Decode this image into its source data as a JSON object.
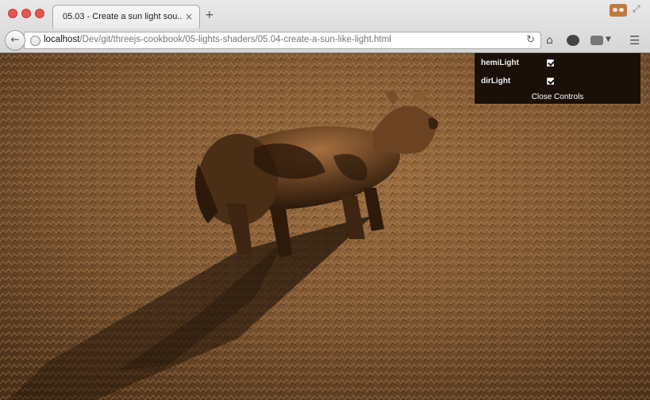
{
  "browser": {
    "tab_title": "05.03 - Create a sun light sou...",
    "tab_close": "×",
    "new_tab": "+",
    "url_host": "localhost",
    "url_path": "/Dev/git/threejs-cookbook/05-lights-shaders/05.04-create-a-sun-like-light.html",
    "icons": [
      "back-arrow-icon",
      "globe-icon",
      "reload-icon",
      "home-icon",
      "extension-icon",
      "menu-icon",
      "private-mask-icon",
      "fullscreen-icon"
    ]
  },
  "gui": {
    "controls": [
      {
        "label": "hemiLight",
        "checked": true
      },
      {
        "label": "dirLight",
        "checked": true
      }
    ],
    "close_label": "Close Controls"
  },
  "colors": {
    "ground": "#6b4a2a",
    "ground_light": "#a97a4a",
    "cow": "#4a2e18",
    "gui_bg": "#1a1008"
  }
}
